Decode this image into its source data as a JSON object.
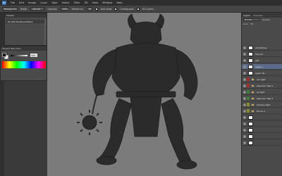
{
  "menubar": {
    "logo": "Ps",
    "items": [
      "File",
      "Edit",
      "Image",
      "Layer",
      "Type",
      "Select",
      "Filter",
      "3D",
      "View",
      "Window",
      "Help"
    ]
  },
  "optionsbar": {
    "size_value": "Background",
    "mode_label": "Mode:",
    "mode_value": "Normal",
    "opacity_label": "Opacity:",
    "opacity_value": "100%",
    "tolerance_label": "Tolerance:",
    "tolerance_value": "32",
    "antialias_label": "Anti-alias",
    "contiguous_label": "Contiguous",
    "all_layers_label": "All Layers"
  },
  "presets_panel": {
    "tab": "Presets",
    "item": "Fill with Bubbles Pattern"
  },
  "color_panel": {
    "tab": "Current Tool Color",
    "slider_value": "100"
  },
  "layers_panel": {
    "tabs": [
      "Layers",
      "Channels"
    ],
    "blend_mode": "Normal",
    "opacity_label": "Opacity:",
    "lock_label": "Lock:",
    "fill_label": "Fill:",
    "layers": [
      {
        "name": "something",
        "type": "layer"
      },
      {
        "name": "line art",
        "type": "layer"
      },
      {
        "name": "grit",
        "type": "layer"
      },
      {
        "name": "Layer 1",
        "type": "layer",
        "selected": true
      },
      {
        "name": "Layer 10...",
        "type": "layer"
      },
      {
        "name": "rim light",
        "type": "group",
        "color": "#a02d2d"
      },
      {
        "name": "specular map 1",
        "type": "group",
        "color": "#a02d2d"
      },
      {
        "name": "ao light",
        "type": "group",
        "color": "#3e7a3e"
      },
      {
        "name": "specular map 1",
        "type": "group",
        "color": "#3e7a3e"
      },
      {
        "name": "primary light",
        "type": "group",
        "color": "#8a8a2e"
      },
      {
        "name": "fill out 1",
        "type": "group",
        "color": "#8a8a2e"
      },
      {
        "name": "",
        "type": "layer"
      },
      {
        "name": "",
        "type": "layer"
      },
      {
        "name": "",
        "type": "layer"
      },
      {
        "name": "",
        "type": "layer"
      },
      {
        "name": "",
        "type": "layer"
      }
    ]
  },
  "canvas": {
    "background_color": "#7b7b7b",
    "figure_color": "#2b2b2b"
  }
}
